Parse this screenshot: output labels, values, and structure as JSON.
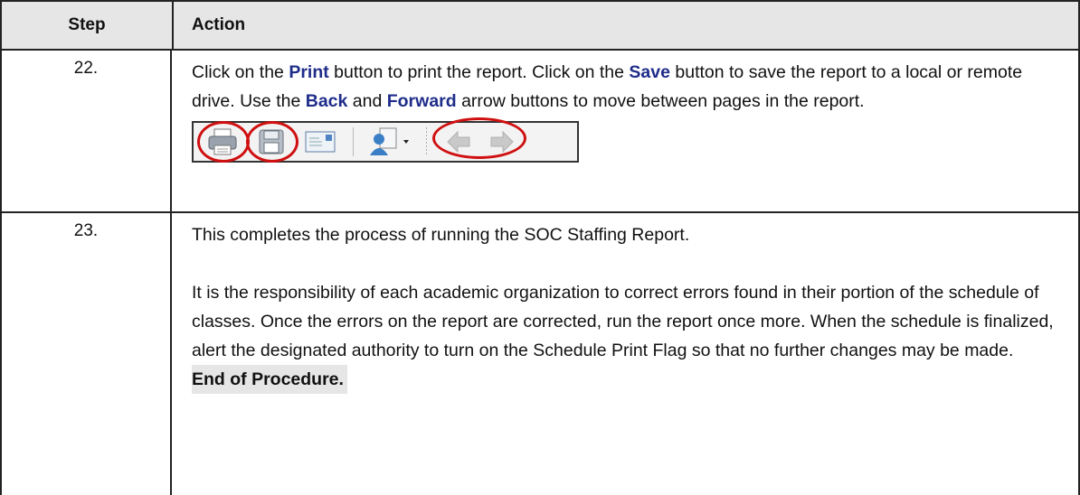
{
  "header": {
    "step_label": "Step",
    "action_label": "Action"
  },
  "rows": [
    {
      "number": "22.",
      "parts": {
        "p1": "Click on the ",
        "kw1": "Print",
        "p2": " button to print the report.  Click on the ",
        "kw2": "Save",
        "p3": " button to save the report to a local or remote drive.  Use the ",
        "kw3": "Back",
        "p4": " and ",
        "kw4": "Forward",
        "p5": " arrow buttons to move between pages in the report."
      },
      "toolbar": {
        "icons": [
          "print-icon",
          "save-icon",
          "email-icon",
          "user-export-icon",
          "back-arrow-icon",
          "forward-arrow-icon"
        ],
        "highlight_color": "#d01010"
      }
    },
    {
      "number": "23.",
      "line1": "This completes the process of running the SOC Staffing Report.",
      "paragraph": "It is the responsibility of each academic organization to correct errors found in their portion of the schedule of classes.  Once the errors on the report are corrected, run the report once more.  When the schedule is finalized, alert the designated authority to turn on the Schedule Print Flag so that no further changes may be made.",
      "end_text": "End of Procedure."
    }
  ],
  "colors": {
    "keyword": "#1f2d8a",
    "header_bg": "#e6e6e6"
  }
}
